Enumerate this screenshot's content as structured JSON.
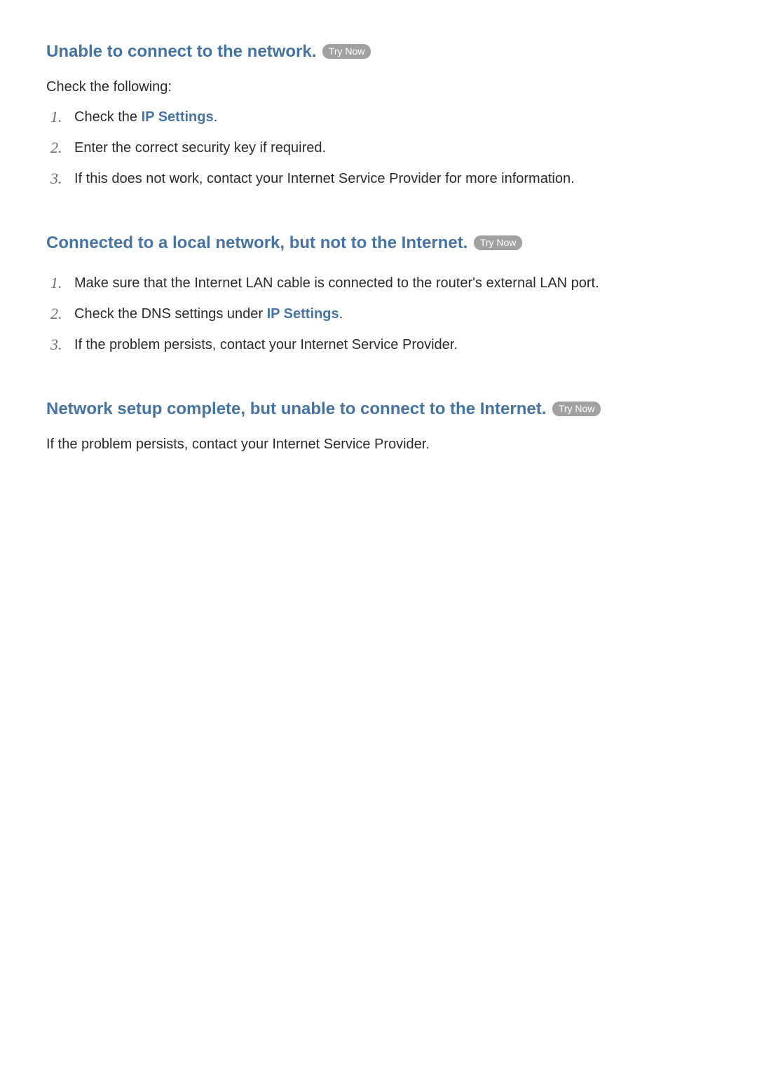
{
  "try_now_label": "Try Now",
  "sections": {
    "s1": {
      "heading": "Unable to connect to the network.",
      "intro": "Check the following:",
      "items": {
        "i1_pre": "Check the ",
        "i1_kw": "IP Settings",
        "i1_post": ".",
        "i2": "Enter the correct security key if required.",
        "i3": "If this does not work, contact your Internet Service Provider for more information."
      }
    },
    "s2": {
      "heading": "Connected to a local network, but not to the Internet.",
      "items": {
        "i1": "Make sure that the Internet LAN cable is connected to the router's external LAN port.",
        "i2_pre": "Check the DNS settings under ",
        "i2_kw": "IP Settings",
        "i2_post": ".",
        "i3": "If the problem persists, contact your Internet Service Provider."
      }
    },
    "s3": {
      "heading": "Network setup complete, but unable to connect to the Internet.",
      "body": "If the problem persists, contact your Internet Service Provider."
    }
  }
}
